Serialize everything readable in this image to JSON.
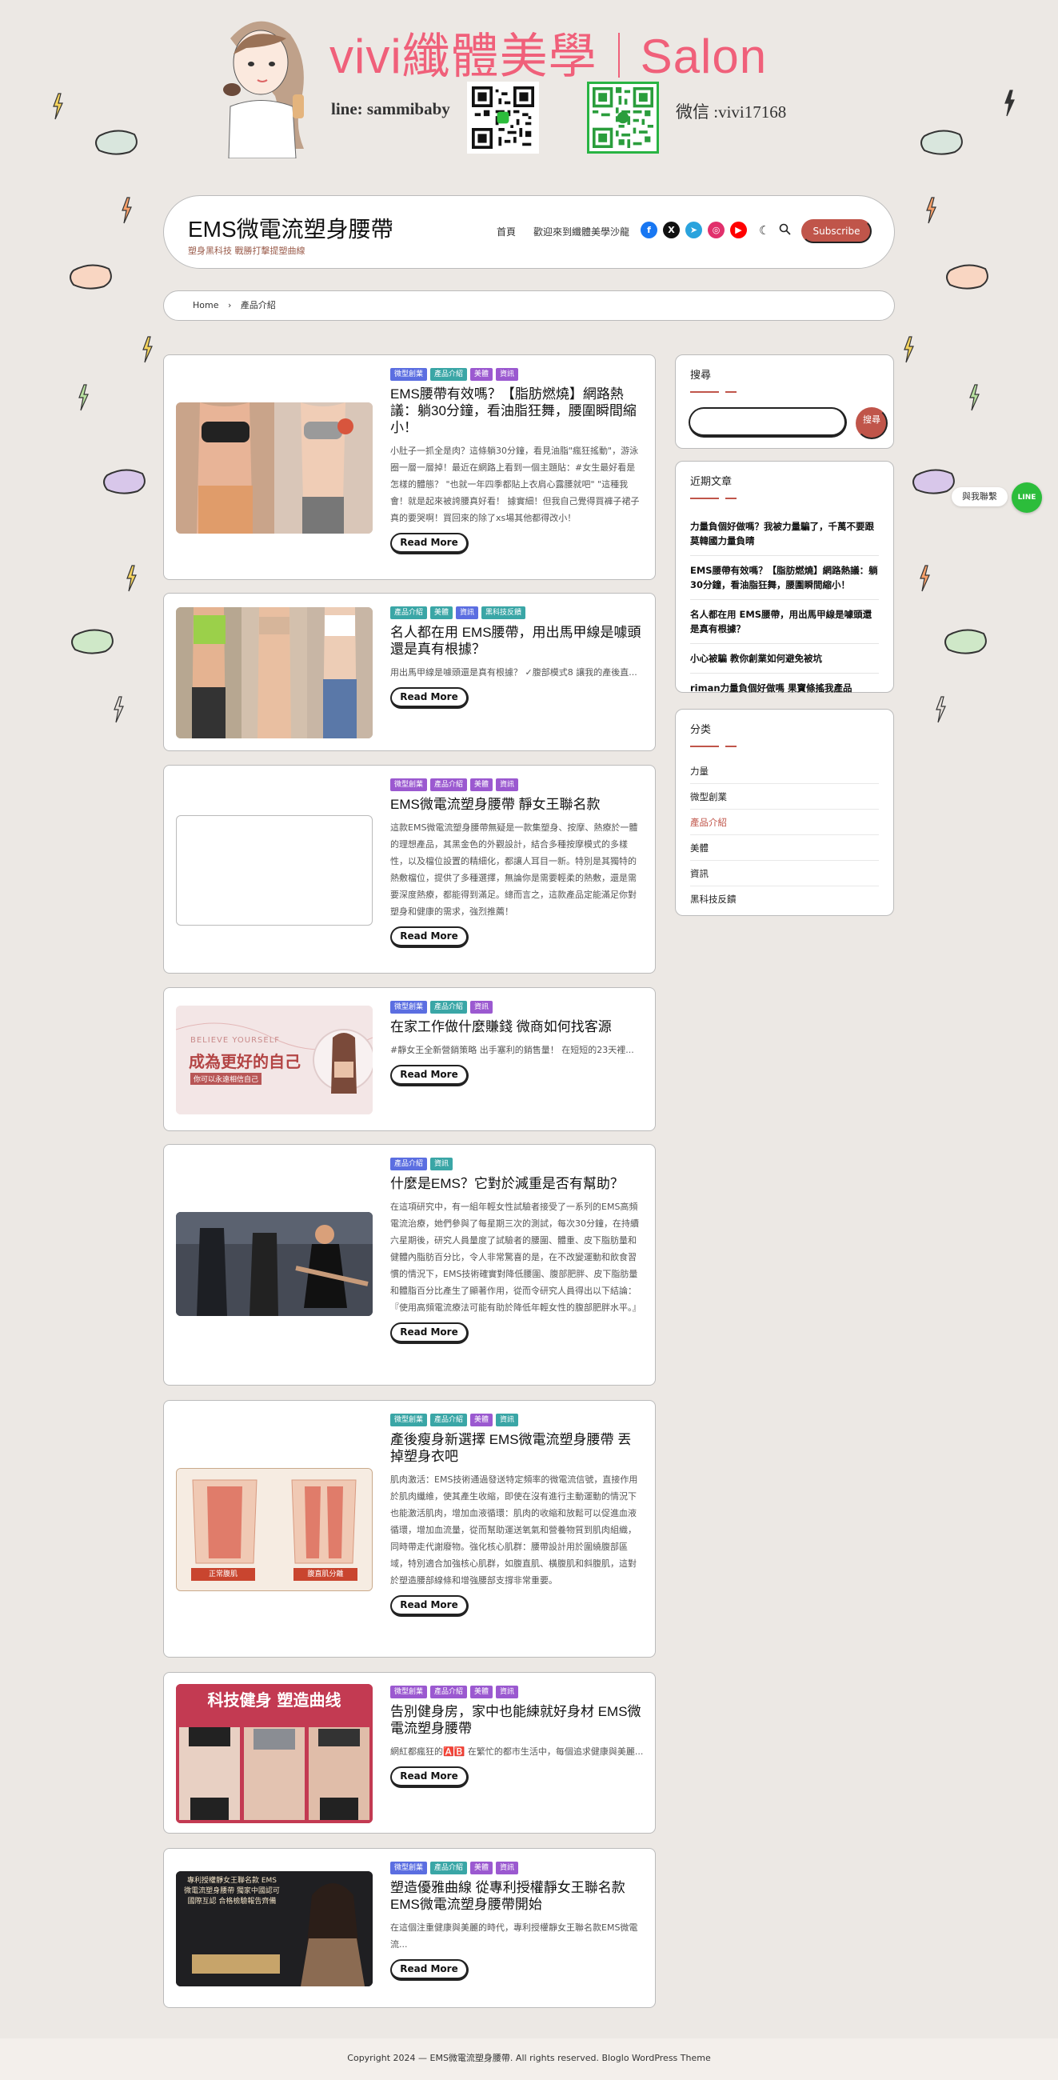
{
  "banner": {
    "brand_left": "vivi纖體美學",
    "brand_right": "Salon",
    "line_id": "line: sammibaby",
    "wechat_id": "微信 :vivi17168"
  },
  "header": {
    "site_title": "EMS微電流塑身腰帶",
    "tagline": "塑身黑科技 戰勝打擊提塑曲線",
    "nav": [
      "首頁",
      "歡迎來到纖體美學沙龍"
    ],
    "socials": [
      {
        "name": "facebook",
        "glyph": "f",
        "color": "#1877f2"
      },
      {
        "name": "x",
        "glyph": "X",
        "color": "#111111"
      },
      {
        "name": "telegram",
        "glyph": "➤",
        "color": "#2aa3dd"
      },
      {
        "name": "instagram",
        "glyph": "◎",
        "color": "#e1306c"
      },
      {
        "name": "youtube",
        "glyph": "▶",
        "color": "#ff0000"
      }
    ],
    "subscribe_label": "Subscribe"
  },
  "breadcrumb": {
    "home": "Home",
    "separator": "›",
    "current": "產品介紹"
  },
  "colors": {
    "accent": "#c0554a",
    "cat_blue": "#5b6ee1",
    "cat_teal": "#3aa6a6",
    "cat_purple": "#9b59d0"
  },
  "posts": [
    {
      "cats": [
        [
          "微型創業",
          "blue"
        ],
        [
          "產品介紹",
          "teal"
        ],
        [
          "美體",
          "purple"
        ],
        [
          "資訊",
          "purple"
        ]
      ],
      "title": "EMS腰帶有效嗎？【脂肪燃燒】網路熱議：躺30分鐘，看油脂狂舞，腰圍瞬間縮小！",
      "excerpt": "小肚子一抓全是肉？這條躺30分鐘，看見油脂\"瘋狂搖動\"，游泳圈一層一層掉！最近在網路上看到一個主題貼：#女生最好看是怎樣的體態？ \"也就一年四季都貼上衣肩心露腰就吧\" \"這種我會！就是起來被誇腰真好看！ 據實細！但我自己覺得買褲子裙子真的要哭啊！買回來的除了xs場其他都得改小！",
      "read_more": "Read More"
    },
    {
      "cats": [
        [
          "產品介紹",
          "teal"
        ],
        [
          "美體",
          "teal"
        ],
        [
          "資訊",
          "blue"
        ],
        [
          "黑科技反饋",
          "teal"
        ]
      ],
      "title": "名人都在用 EMS腰帶，用出馬甲線是噱頭還是真有根據？",
      "excerpt": "用出馬甲線是噱頭還是真有根據？ ✓腹部模式8 讓我的產後直...",
      "read_more": "Read More"
    },
    {
      "cats": [
        [
          "微型創業",
          "purple"
        ],
        [
          "產品介紹",
          "purple"
        ],
        [
          "美體",
          "purple"
        ],
        [
          "資訊",
          "purple"
        ]
      ],
      "title": "EMS微電流塑身腰帶 靜女王聯名款",
      "excerpt": "這款EMS微電流塑身腰帶無疑是一款集塑身、按摩、熱療於一體的理想產品，其黑金色的外觀設計，結合多種按摩模式的多樣性，以及檔位設置的精細化，都讓人耳目一新。特別是其獨特的熱敷檔位，提供了多種選擇，無論你是需要輕柔的熱敷，還是需要深度熱療，都能得到滿足。總而言之，這款產品定能滿足你對塑身和健康的需求，強烈推薦！",
      "read_more": "Read More"
    },
    {
      "cats": [
        [
          "微型創業",
          "blue"
        ],
        [
          "產品介紹",
          "teal"
        ],
        [
          "資訊",
          "purple"
        ]
      ],
      "title": "在家工作做什麼賺錢 微商如何找客源",
      "excerpt": "#靜女王全新營銷策略 出手塞利的銷售量！ 在短短的23天裡...",
      "read_more": "Read More"
    },
    {
      "cats": [
        [
          "產品介紹",
          "blue"
        ],
        [
          "資訊",
          "teal"
        ]
      ],
      "title": "什麼是EMS？它對於減重是否有幫助？",
      "excerpt": "在這項研究中，有一組年輕女性試驗者接受了一系列的EMS高頻電流治療，她們參與了每星期三次的測試，每次30分鐘，在持續六星期後，研究人員量度了試驗者的腰圍、體重、皮下脂肪量和健體內脂肪百分比，令人非常驚喜的是，在不改變運動和飲食習慣的情況下，EMS技術確實對降低腰圍、腹部肥胖、皮下脂肪量和體脂百分比產生了顯著作用，從而令研究人員得出以下結論：『使用高頻電流療法可能有助於降低年輕女性的腹部肥胖水平。』",
      "read_more": "Read More"
    },
    {
      "cats": [
        [
          "微型創業",
          "teal"
        ],
        [
          "產品介紹",
          "teal"
        ],
        [
          "美體",
          "purple"
        ],
        [
          "資訊",
          "teal"
        ]
      ],
      "title": "產後瘦身新選擇 EMS微電流塑身腰帶 丟掉塑身衣吧",
      "excerpt": "肌肉激活：EMS技術通過發送特定頻率的微電流信號，直接作用於肌肉纖維，使其產生收縮，即使在沒有進行主動運動的情況下也能激活肌肉，增加血液循環：肌肉的收縮和放鬆可以促進血液循環，增加血流量，從而幫助運送氧氣和營養物質到肌肉組織，同時帶走代謝廢物。強化核心肌群：腰帶設計用於圍繞腹部區域，特別適合加強核心肌群，如腹直肌、橫腹肌和斜腹肌，這對於塑造腰部線條和增強腰部支撐非常重要。",
      "read_more": "Read More"
    },
    {
      "cats": [
        [
          "微型創業",
          "purple"
        ],
        [
          "產品介紹",
          "purple"
        ],
        [
          "美體",
          "purple"
        ],
        [
          "資訊",
          "purple"
        ]
      ],
      "title": "告別健身房，家中也能練就好身材 EMS微電流塑身腰帶",
      "excerpt": "網紅都瘋狂的🅰️🅱️ 在繁忙的都市生活中，每個追求健康與美麗...",
      "read_more": "Read More"
    },
    {
      "cats": [
        [
          "微型創業",
          "blue"
        ],
        [
          "產品介紹",
          "teal"
        ],
        [
          "美體",
          "purple"
        ],
        [
          "資訊",
          "purple"
        ]
      ],
      "title": "塑造優雅曲線 從專利授權靜女王聯名款EMS微電流塑身腰帶開始",
      "excerpt": "在這個注重健康與美麗的時代，專利授權靜女王聯名款EMS微電流...",
      "read_more": "Read More"
    }
  ],
  "thumbs": {
    "thumb4_text1": "BELIEVE YOURSELF",
    "thumb4_text2": "成為更好的自己",
    "thumb4_text3": "你可以永遠相信自己",
    "thumb6_label_left": "正常腹肌",
    "thumb6_label_right": "腹直肌分離",
    "thumb7_title": "科技健身 塑造曲线",
    "thumb8_text": "專利授權靜女王聯名款 EMS微電流塑身腰帶 獨家中國認可 國際互認 合格檢驗報告齊備"
  },
  "sidebar": {
    "search_title": "搜尋",
    "search_button": "搜尋",
    "search_value": "",
    "recent_title": "近期文章",
    "recent_posts": [
      "力量負個好做嗎？我被力量騙了，千萬不要跟莫韓國力量負晴",
      "EMS腰帶有效嗎？【脂肪燃燒】網路熱議：躺30分鐘，看油脂狂舞，腰圍瞬間縮小！",
      "名人都在用 EMS腰帶，用出馬甲線是噱頭還是真有根據？",
      "小心被騙 教你創業如何避免被坑",
      "riman力量負個好做嗎 果寶條搖我產品"
    ],
    "category_title": "分类",
    "categories": [
      {
        "label": "力量",
        "active": false
      },
      {
        "label": "微型創業",
        "active": false
      },
      {
        "label": "產品介紹",
        "active": true
      },
      {
        "label": "美體",
        "active": false
      },
      {
        "label": "資訊",
        "active": false
      },
      {
        "label": "黑科技反饋",
        "active": false
      }
    ]
  },
  "chat": {
    "label": "與我聯繫",
    "badge": "LINE"
  },
  "footer": {
    "text": "Copyright 2024 — EMS微電流塑身腰帶. All rights reserved. Bloglo WordPress Theme"
  }
}
